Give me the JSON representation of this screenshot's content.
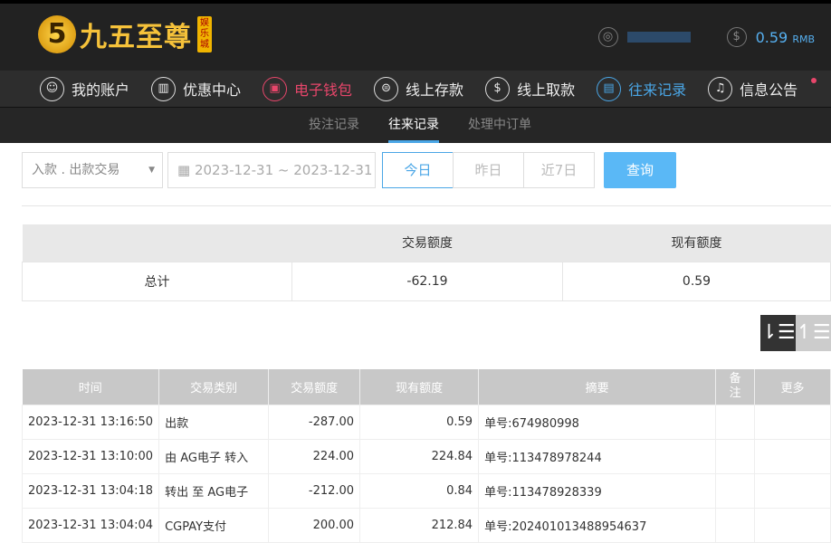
{
  "logo": {
    "badge": "5",
    "name": "九五至尊",
    "tag": "娱乐城"
  },
  "user": {
    "balance": "0.59",
    "currency": "RMB"
  },
  "nav": [
    {
      "label": "我的账户",
      "icon": "user"
    },
    {
      "label": "优惠中心",
      "icon": "gift"
    },
    {
      "label": "电子钱包",
      "icon": "wallet"
    },
    {
      "label": "线上存款",
      "icon": "deposit"
    },
    {
      "label": "线上取款",
      "icon": "withdraw"
    },
    {
      "label": "往来记录",
      "icon": "records"
    },
    {
      "label": "信息公告",
      "icon": "bell"
    }
  ],
  "subnav": [
    "投注记录",
    "往来记录",
    "处理中订单"
  ],
  "filters": {
    "type": "入款 . 出款交易",
    "date_range": "2023-12-31 ~ 2023-12-31",
    "quick": [
      "今日",
      "昨日",
      "近7日"
    ],
    "search": "查询"
  },
  "summary": {
    "headers": [
      "",
      "交易额度",
      "现有额度"
    ],
    "row": [
      "总计",
      "-62.19",
      "0.59"
    ]
  },
  "table": {
    "headers": [
      "时间",
      "交易类别",
      "交易额度",
      "现有额度",
      "摘要",
      "备注",
      "更多"
    ],
    "rows": [
      [
        "2023-12-31 13:16:50",
        "出款",
        "-287.00",
        "0.59",
        "单号:674980998",
        "",
        ""
      ],
      [
        "2023-12-31 13:10:00",
        "由 AG电子 转入",
        "224.00",
        "224.84",
        "单号:113478978244",
        "",
        ""
      ],
      [
        "2023-12-31 13:04:18",
        "转出 至 AG电子",
        "-212.00",
        "0.84",
        "单号:113478928339",
        "",
        ""
      ],
      [
        "2023-12-31 13:04:04",
        "CGPAY支付",
        "200.00",
        "212.84",
        "单号:202401013488954637",
        "",
        ""
      ]
    ]
  },
  "colors": {
    "accent": "#4aa6e6",
    "active_red": "#e8466b"
  }
}
